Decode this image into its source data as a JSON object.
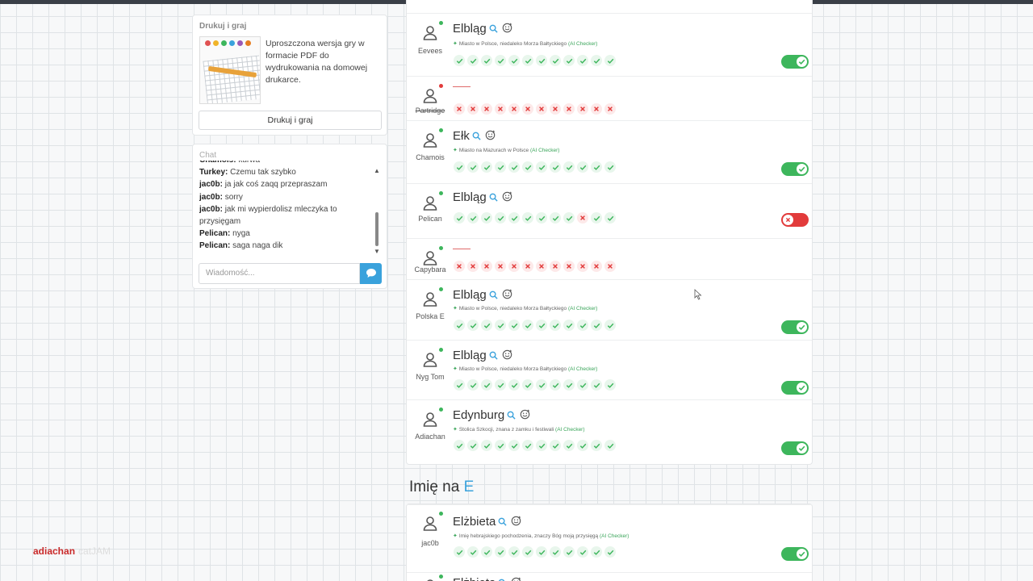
{
  "print_card": {
    "title": "Drukuj i graj",
    "description": "Uproszczona wersja gry w formacie PDF do wydrukowania na domowej drukarce.",
    "button_label": "Drukuj i graj"
  },
  "chat": {
    "title": "Chat",
    "messages": [
      {
        "user": "Chamois:",
        "text": "kurwa"
      },
      {
        "user": "Turkey:",
        "text": "Czemu tak szybko"
      },
      {
        "user": "jac0b:",
        "text": "ja jak coś zaqq przepraszam"
      },
      {
        "user": "jac0b:",
        "text": "sorry"
      },
      {
        "user": "jac0b:",
        "text": "jak mi wypierdolisz mleczyka to"
      },
      {
        "user": "",
        "text": "przysięgam"
      },
      {
        "user": "Pelican:",
        "text": "nyga"
      },
      {
        "user": "Pelican:",
        "text": "saga naga dik"
      }
    ],
    "input_placeholder": "Wiadomość..."
  },
  "rows": [
    {
      "user": "Eevees",
      "answer": "Elbląg",
      "desc": "Miasto w Polsce, niedaleko Morza Bałtyckiego",
      "ai": "(AI Checker)",
      "marks": "cccccccccccc",
      "toggle": "on",
      "dot": "green"
    },
    {
      "user": "Partridge",
      "answer": "",
      "desc": "",
      "ai": "",
      "marks": "xxxxxxxxxxxx",
      "toggle": "",
      "dot": "red"
    },
    {
      "user": "Chamois",
      "answer": "Ełk",
      "desc": "Miasto na Mazurach w Polsce",
      "ai": "(AI Checker)",
      "marks": "cccccccccccc",
      "toggle": "on",
      "dot": "green"
    },
    {
      "user": "Pelican",
      "answer": "Elbląg",
      "desc": "",
      "ai": "",
      "marks": "cccccccccxcc",
      "toggle": "off",
      "dot": "green"
    },
    {
      "user": "Capybara",
      "answer": "",
      "desc": "",
      "ai": "",
      "marks": "xxxxxxxxxxxx",
      "toggle": "",
      "dot": "green"
    },
    {
      "user": "Polska E",
      "answer": "Elbląg",
      "desc": "Miasto w Polsce, niedaleko Morza Bałtyckiego",
      "ai": "(AI Checker)",
      "marks": "cccccccccccc",
      "toggle": "on",
      "dot": "green"
    },
    {
      "user": "Nyg Tom",
      "answer": "Elbląg",
      "desc": "Miasto w Polsce, niedaleko Morza Bałtyckiego",
      "ai": "(AI Checker)",
      "marks": "cccccccccccc",
      "toggle": "on",
      "dot": "green"
    },
    {
      "user": "Adiachan",
      "answer": "Edynburg",
      "desc": "Stolica Szkocji, znana z zamku i festiwali",
      "ai": "(AI Checker)",
      "marks": "cccccccccccc",
      "toggle": "on",
      "dot": "green"
    }
  ],
  "section": {
    "prefix": "Imię na ",
    "letter": "E"
  },
  "rows2": [
    {
      "user": "jac0b",
      "answer": "Elżbieta",
      "desc": "Imię hebrajskiego pochodzenia, znaczy Bóg moją przysięgą",
      "ai": "(AI Checker)",
      "marks": "cccccccccccc",
      "toggle": "on",
      "dot": "green"
    },
    {
      "user": "",
      "answer": "Elżbieta",
      "desc": "",
      "ai": "",
      "marks": "",
      "toggle": "",
      "dot": "green"
    }
  ],
  "watermark": {
    "user": "adiachan",
    "cat": "catJAM"
  },
  "colors": {
    "accent": "#3aa2dc",
    "ok": "#3db65c",
    "bad": "#e23b3b"
  }
}
